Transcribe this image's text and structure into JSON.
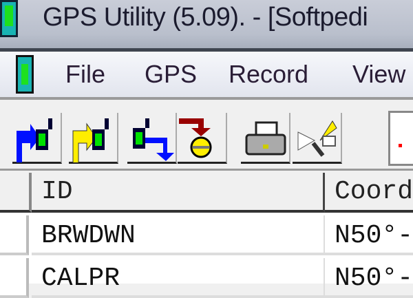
{
  "window": {
    "title": "GPS Utility (5.09). - [Softpedi"
  },
  "menu": {
    "items": [
      "File",
      "GPS",
      "Record",
      "View"
    ]
  },
  "toolbar": {
    "buttons": [
      "upload-waypoints",
      "upload-routes",
      "download",
      "record-drop",
      "print",
      "disconnect"
    ]
  },
  "grid": {
    "columns": [
      "ID",
      "Coord"
    ],
    "rows": [
      [
        "BRWDWN",
        "N50°-"
      ],
      [
        "CALPR",
        "N50°-"
      ]
    ]
  }
}
